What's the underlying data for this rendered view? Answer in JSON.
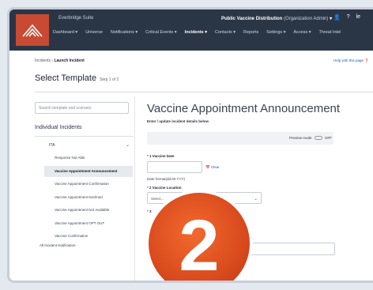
{
  "header": {
    "brand": "Everbridge Suite",
    "title": "Public Vaccine Distribution",
    "subtitle": "(Organization Admin)",
    "icons": [
      "user-icon",
      "help-icon"
    ],
    "user_initials": "le"
  },
  "nav": {
    "items": [
      {
        "label": "Dashboard ▾",
        "active": false
      },
      {
        "label": "Universe",
        "active": false
      },
      {
        "label": "Notifications ▾",
        "active": false
      },
      {
        "label": "Critical Events ▾",
        "active": false
      },
      {
        "label": "Incidents ▾",
        "active": true
      },
      {
        "label": "Contacts ▾",
        "active": false
      },
      {
        "label": "Reports",
        "active": false
      },
      {
        "label": "Settings ▾",
        "active": false
      },
      {
        "label": "Access ▾",
        "active": false
      },
      {
        "label": "Threat Intel",
        "active": false
      }
    ]
  },
  "breadcrumb": {
    "parent": "Incidents",
    "sep": "›",
    "current": "Launch Incident"
  },
  "help_link": "Help with this page",
  "page": {
    "title": "Select Template",
    "step": "Step 1 of 2"
  },
  "sidebar": {
    "search_placeholder": "Search template and scenario",
    "section_title": "Individual Incidents",
    "folder": "ITA",
    "templates": [
      {
        "label": "Response Not Able",
        "selected": false
      },
      {
        "label": "Vaccine Appointment Announcement",
        "selected": true
      },
      {
        "label": "Vaccine Appointment Confirmation",
        "selected": false
      },
      {
        "label": "Vaccine Appointment Declined",
        "selected": false
      },
      {
        "label": "Vaccine Appointment Not Available",
        "selected": false
      },
      {
        "label": "Vaccine Appointment OPT OUT",
        "selected": false
      },
      {
        "label": "Vaccine Confirmation",
        "selected": false
      }
    ],
    "all_incidents": "All Incident Notification"
  },
  "form": {
    "title": "Vaccine Appointment Announcement",
    "subtitle": "Enter / update incident details below",
    "preview_label": "Preview mode",
    "preview_state": "OFF",
    "field1_label": "1 Vaccine Date",
    "clear_label": "Clear",
    "date_hint": "Date format(dd:00 YYY)",
    "field2_label": "2 Vaccine Location",
    "select_placeholder": "Select...",
    "field3_label": "3"
  },
  "overlay": {
    "number": "2"
  },
  "colors": {
    "topbar": "#2a3646",
    "logo": "#c84a32",
    "badge": "#e0521f",
    "link": "#1b5ea8"
  }
}
